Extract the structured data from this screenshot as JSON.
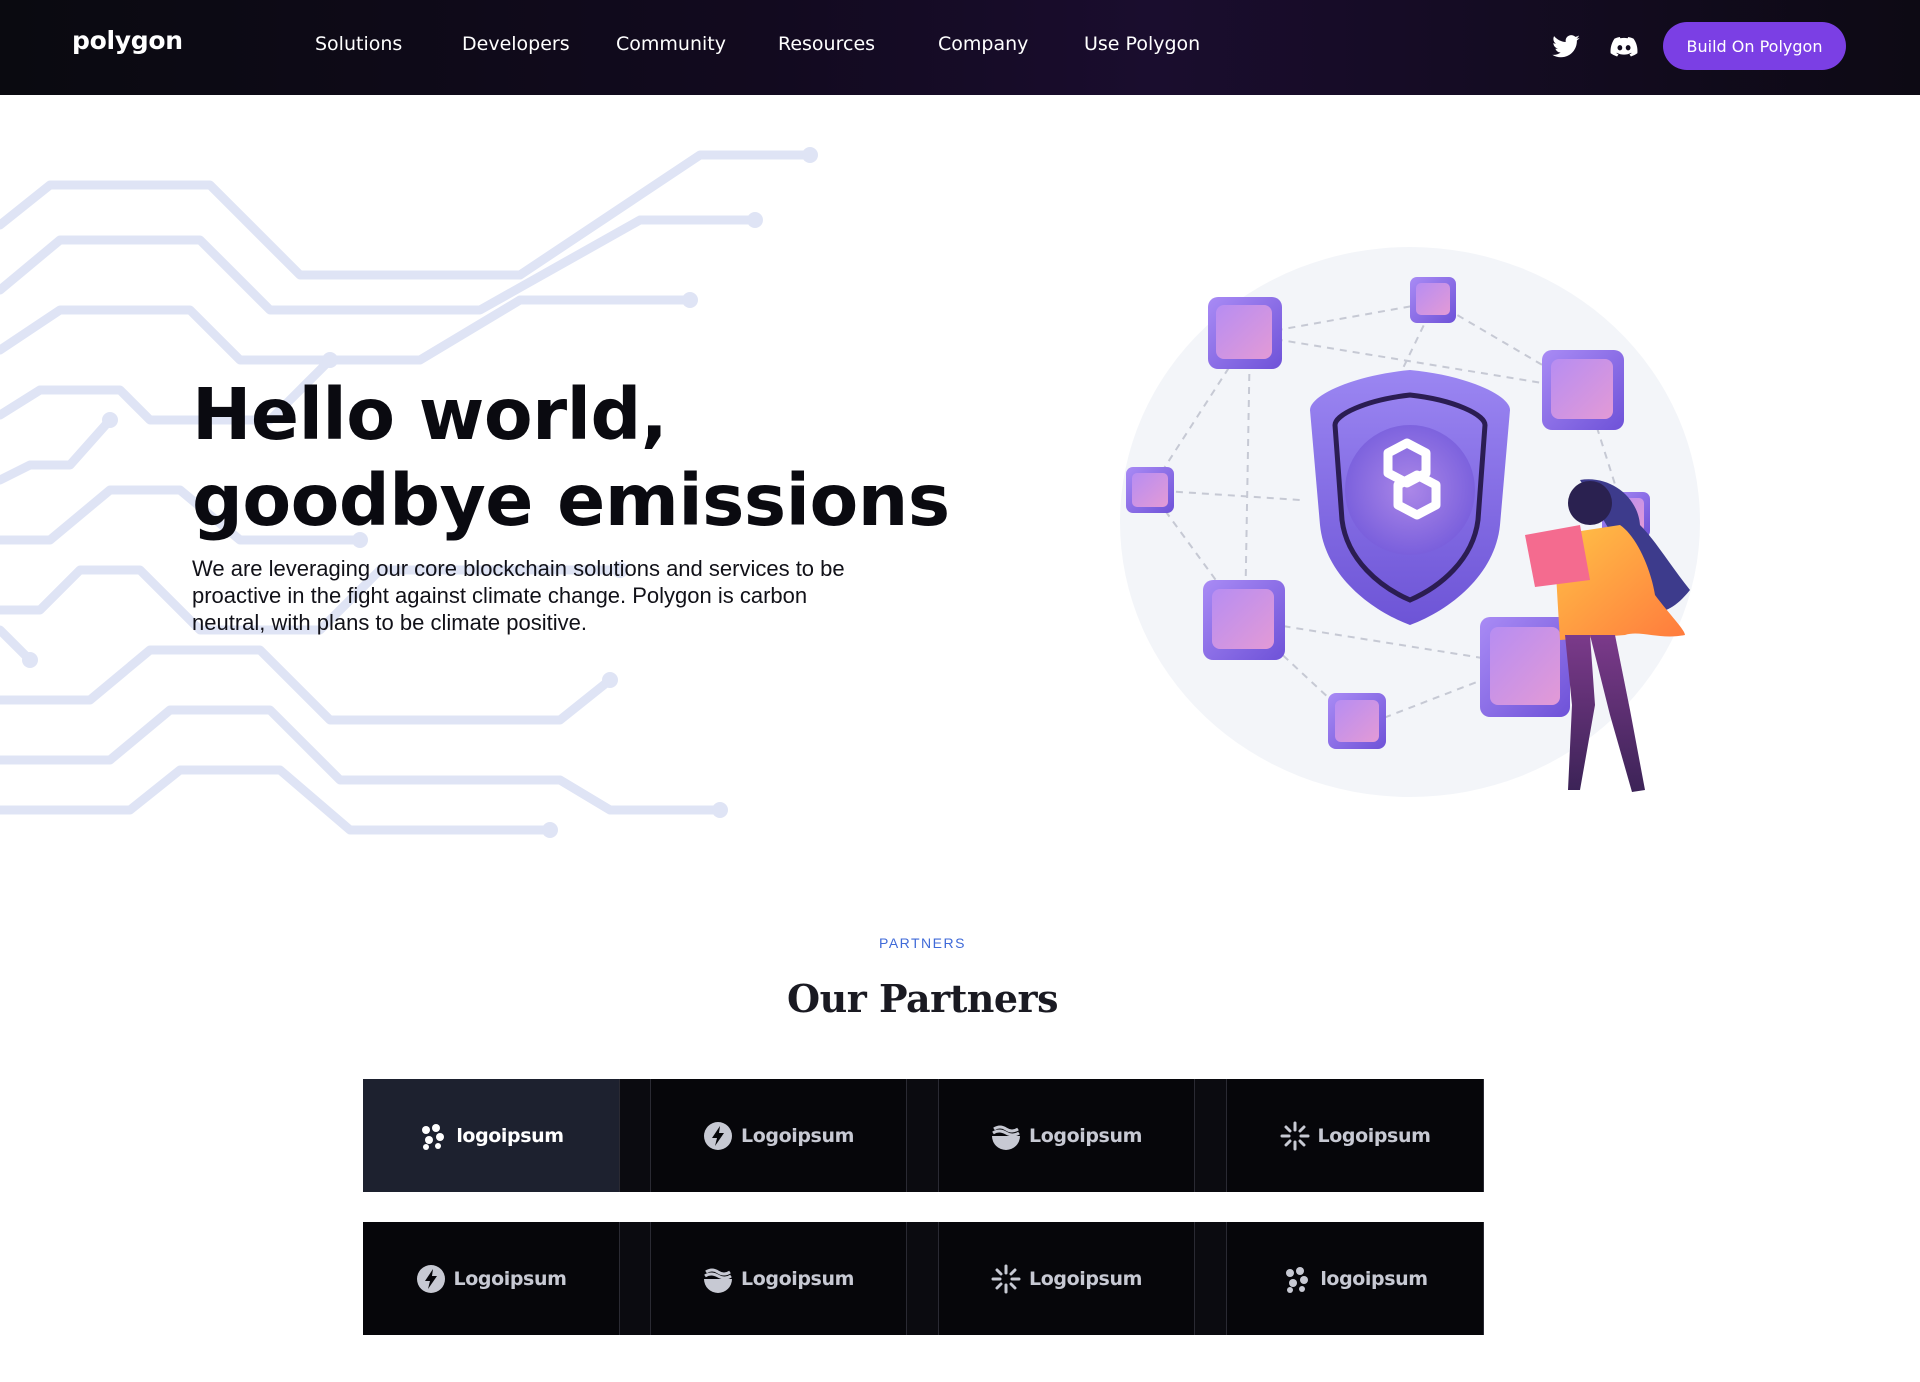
{
  "header": {
    "logo": "polygon",
    "nav": [
      "Solutions",
      "Developers",
      "Community",
      "Resources",
      "Company",
      "Use Polygon"
    ],
    "social": [
      "twitter-icon",
      "discord-icon"
    ],
    "cta_label": "Build On Polygon",
    "cta_color": "#7b3fe4"
  },
  "hero": {
    "title_line1": "Hello world,",
    "title_line2": "goodbye emissions",
    "subtitle": "We are leveraging our core blockchain solutions and services to be proactive in the fight against climate change. Polygon is carbon neutral, with plans to be climate positive."
  },
  "partners": {
    "eyebrow": "PARTNERS",
    "title": "Our Partners",
    "row1": [
      {
        "label": "logoipsum",
        "icon": "blob-icon",
        "active": true
      },
      {
        "label": "Logoipsum",
        "icon": "bolt-icon",
        "active": false
      },
      {
        "label": "Logoipsum",
        "icon": "waves-icon",
        "active": false
      },
      {
        "label": "Logoipsum",
        "icon": "sunburst-icon",
        "active": false
      }
    ],
    "row2": [
      {
        "label": "Logoipsum",
        "icon": "bolt-icon",
        "active": false
      },
      {
        "label": "Logoipsum",
        "icon": "waves-icon",
        "active": false
      },
      {
        "label": "Logoipsum",
        "icon": "sunburst-icon",
        "active": false
      },
      {
        "label": "logoipsum",
        "icon": "blob-icon",
        "active": false
      }
    ]
  }
}
